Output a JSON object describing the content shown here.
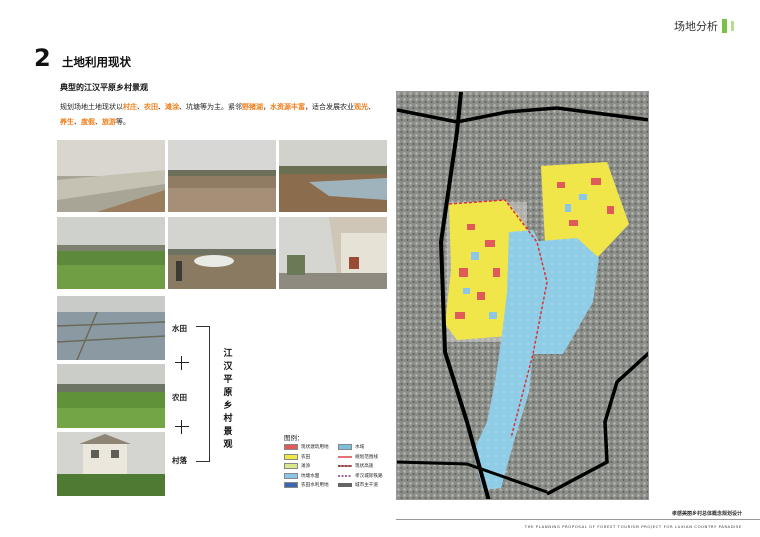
{
  "header": {
    "tag": "场地分析"
  },
  "section": {
    "number": "2",
    "title": "土地利用现状"
  },
  "subtitle": "典型的江汉平原乡村景观",
  "description": {
    "segments": [
      {
        "text": "规划场地土地现状以",
        "highlight": false
      },
      {
        "text": "村庄",
        "highlight": true
      },
      {
        "text": "、",
        "highlight": false
      },
      {
        "text": "农田",
        "highlight": true
      },
      {
        "text": "、",
        "highlight": false
      },
      {
        "text": "滩涂",
        "highlight": true
      },
      {
        "text": "、坑塘等为主。紧邻",
        "highlight": false
      },
      {
        "text": "野猪湖",
        "highlight": true
      },
      {
        "text": "，",
        "highlight": false
      },
      {
        "text": "水资源丰富",
        "highlight": true
      },
      {
        "text": "，适合发展农业",
        "highlight": false
      },
      {
        "text": "观光",
        "highlight": true
      },
      {
        "text": "、",
        "highlight": false
      },
      {
        "text": "养生",
        "highlight": true
      },
      {
        "text": "、",
        "highlight": false
      },
      {
        "text": "度假",
        "highlight": true
      },
      {
        "text": "、",
        "highlight": false
      },
      {
        "text": "旅游",
        "highlight": true
      },
      {
        "text": "等。",
        "highlight": false
      }
    ],
    "highlight_color": "#f07f1c"
  },
  "land_types": {
    "paddy": "水田",
    "farmland": "农田",
    "village": "村落",
    "vertical_title": [
      "江",
      "汉",
      "平",
      "原",
      "乡",
      "村",
      "景",
      "观"
    ]
  },
  "legend": {
    "title": "图例：",
    "items": [
      {
        "label": "现状建筑用地",
        "color": "#e05a5a",
        "kind": "fill"
      },
      {
        "label": "水域",
        "color": "#7bbfdc",
        "kind": "fill"
      },
      {
        "label": "农田",
        "color": "#f0e64a",
        "kind": "fill"
      },
      {
        "label": "规划范围线",
        "color": "#d9343a",
        "kind": "line-solid"
      },
      {
        "label": "滩涂",
        "color": "#d9e88a",
        "kind": "fill"
      },
      {
        "label": "现状高速",
        "color": "#222222",
        "kind": "line-dashred"
      },
      {
        "label": "坑塘水面",
        "color": "#8cc6e8",
        "kind": "fill"
      },
      {
        "label": "孝汉城际铁路",
        "color": "#8c2d7a",
        "kind": "line-dash"
      },
      {
        "label": "农田水利用地",
        "color": "#3a67b0",
        "kind": "fill"
      },
      {
        "label": "城市主干道",
        "color": "#222222",
        "kind": "line-double"
      }
    ]
  },
  "footer": {
    "title": "孝感美丽乡村总体概念规划设计",
    "subtitle": "THE PLANNING PROPOSAL OF FOREST TOURISM PROJECT FOR LUXIAN COUNTRY PARADISE"
  }
}
